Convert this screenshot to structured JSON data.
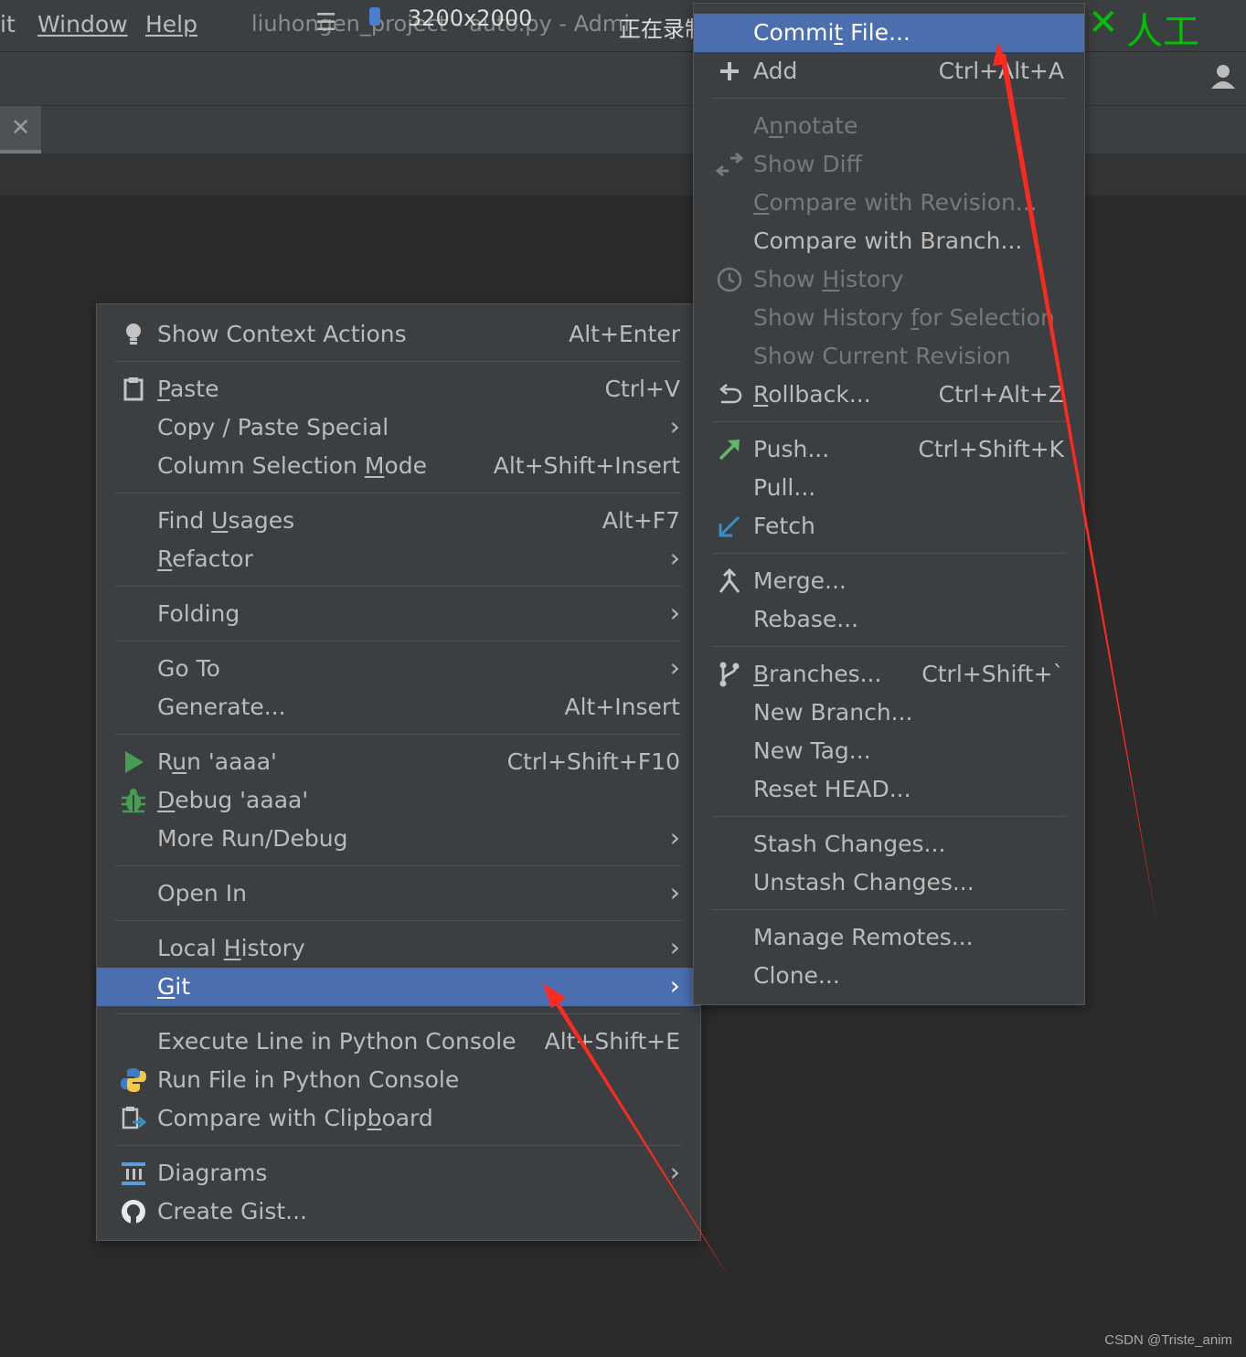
{
  "menubar": {
    "partial_item": "it",
    "items": [
      {
        "label": "Window",
        "mnemonic_index": 0
      },
      {
        "label": "Help",
        "mnemonic_index": 0
      }
    ],
    "title": "liuhongen_project - auto.py - Admi",
    "recording_overlay": "3200x2000",
    "recording_status": "正在录制",
    "right_overlay_text": "人工"
  },
  "tab": {
    "close_glyph": "✕"
  },
  "context_menu": {
    "show_context_actions": {
      "label": "Show Context Actions",
      "shortcut": "Alt+Enter"
    },
    "paste": {
      "label_before": "",
      "mnemonic": "P",
      "label_after": "aste",
      "shortcut": "Ctrl+V"
    },
    "copy_paste_special": {
      "label": "Copy / Paste Special",
      "arrow": "›"
    },
    "column_selection_mode": {
      "label_before": "Column Selection ",
      "mnemonic": "M",
      "label_after": "ode",
      "shortcut": "Alt+Shift+Insert"
    },
    "find_usages": {
      "label_before": "Find ",
      "mnemonic": "U",
      "label_after": "sages",
      "shortcut": "Alt+F7"
    },
    "refactor": {
      "label_before": "",
      "mnemonic": "R",
      "label_after": "efactor",
      "arrow": "›"
    },
    "folding": {
      "label": "Folding",
      "arrow": "›"
    },
    "go_to": {
      "label": "Go To",
      "arrow": "›"
    },
    "generate": {
      "label": "Generate...",
      "shortcut": "Alt+Insert"
    },
    "run": {
      "label_before": "R",
      "mnemonic": "u",
      "label_after": "n 'aaaa'",
      "shortcut": "Ctrl+Shift+F10"
    },
    "debug": {
      "label_before": "",
      "mnemonic": "D",
      "label_after": "ebug 'aaaa'"
    },
    "more_run_debug": {
      "label": "More Run/Debug",
      "arrow": "›"
    },
    "open_in": {
      "label": "Open In",
      "arrow": "›"
    },
    "local_history": {
      "label_before": "Local ",
      "mnemonic": "H",
      "label_after": "istory",
      "arrow": "›"
    },
    "git": {
      "label_before": "",
      "mnemonic": "G",
      "label_after": "it",
      "arrow": "›"
    },
    "execute_line": {
      "label": "Execute Line in Python Console",
      "shortcut": "Alt+Shift+E"
    },
    "run_file_console": {
      "label": "Run File in Python Console"
    },
    "compare_clipboard": {
      "label_before": "Compare with Clip",
      "mnemonic": "b",
      "label_after": "oard"
    },
    "diagrams": {
      "label": "Diagrams",
      "arrow": "›"
    },
    "create_gist": {
      "label": "Create Gist..."
    }
  },
  "git_menu": {
    "commit_file": {
      "label_before": "Commi",
      "mnemonic": "t",
      "label_after": " File..."
    },
    "add": {
      "label": "Add",
      "shortcut": "Ctrl+Alt+A"
    },
    "annotate": {
      "label_before": "A",
      "mnemonic": "n",
      "label_after": "notate"
    },
    "show_diff": {
      "label": "Show Diff"
    },
    "compare_revision": {
      "label_before": "",
      "mnemonic": "C",
      "label_after": "ompare with Revision..."
    },
    "compare_branch": {
      "label": "Compare with Branch..."
    },
    "show_history": {
      "label_before": "Show ",
      "mnemonic": "H",
      "label_after": "istory"
    },
    "show_history_selection": {
      "label_before": "Show History ",
      "mnemonic": "f",
      "label_after": "or Selection"
    },
    "show_current_revision": {
      "label": "Show Current Revision"
    },
    "rollback": {
      "label_before": "",
      "mnemonic": "R",
      "label_after": "ollback...",
      "shortcut": "Ctrl+Alt+Z"
    },
    "push": {
      "label": "Push...",
      "shortcut": "Ctrl+Shift+K"
    },
    "pull": {
      "label": "Pull..."
    },
    "fetch": {
      "label": "Fetch"
    },
    "merge": {
      "label": "Merge..."
    },
    "rebase": {
      "label": "Rebase..."
    },
    "branches": {
      "label_before": "",
      "mnemonic": "B",
      "label_after": "ranches...",
      "shortcut": "Ctrl+Shift+`"
    },
    "new_branch": {
      "label": "New Branch..."
    },
    "new_tag": {
      "label": "New Tag..."
    },
    "reset_head": {
      "label": "Reset HEAD..."
    },
    "stash": {
      "label": "Stash Changes..."
    },
    "unstash": {
      "label": "Unstash Changes..."
    },
    "manage_remotes": {
      "label": "Manage Remotes..."
    },
    "clone": {
      "label": "Clone..."
    }
  },
  "colors": {
    "menu_bg": "#3c3f41",
    "selection": "#4b6eaf",
    "annotation_arrow": "#ff2a1f",
    "run_green": "#499c54",
    "push_green": "#5fb865",
    "fetch_blue": "#3592c4",
    "overlay_green": "#00c000"
  },
  "watermark": "CSDN @Triste_anim"
}
